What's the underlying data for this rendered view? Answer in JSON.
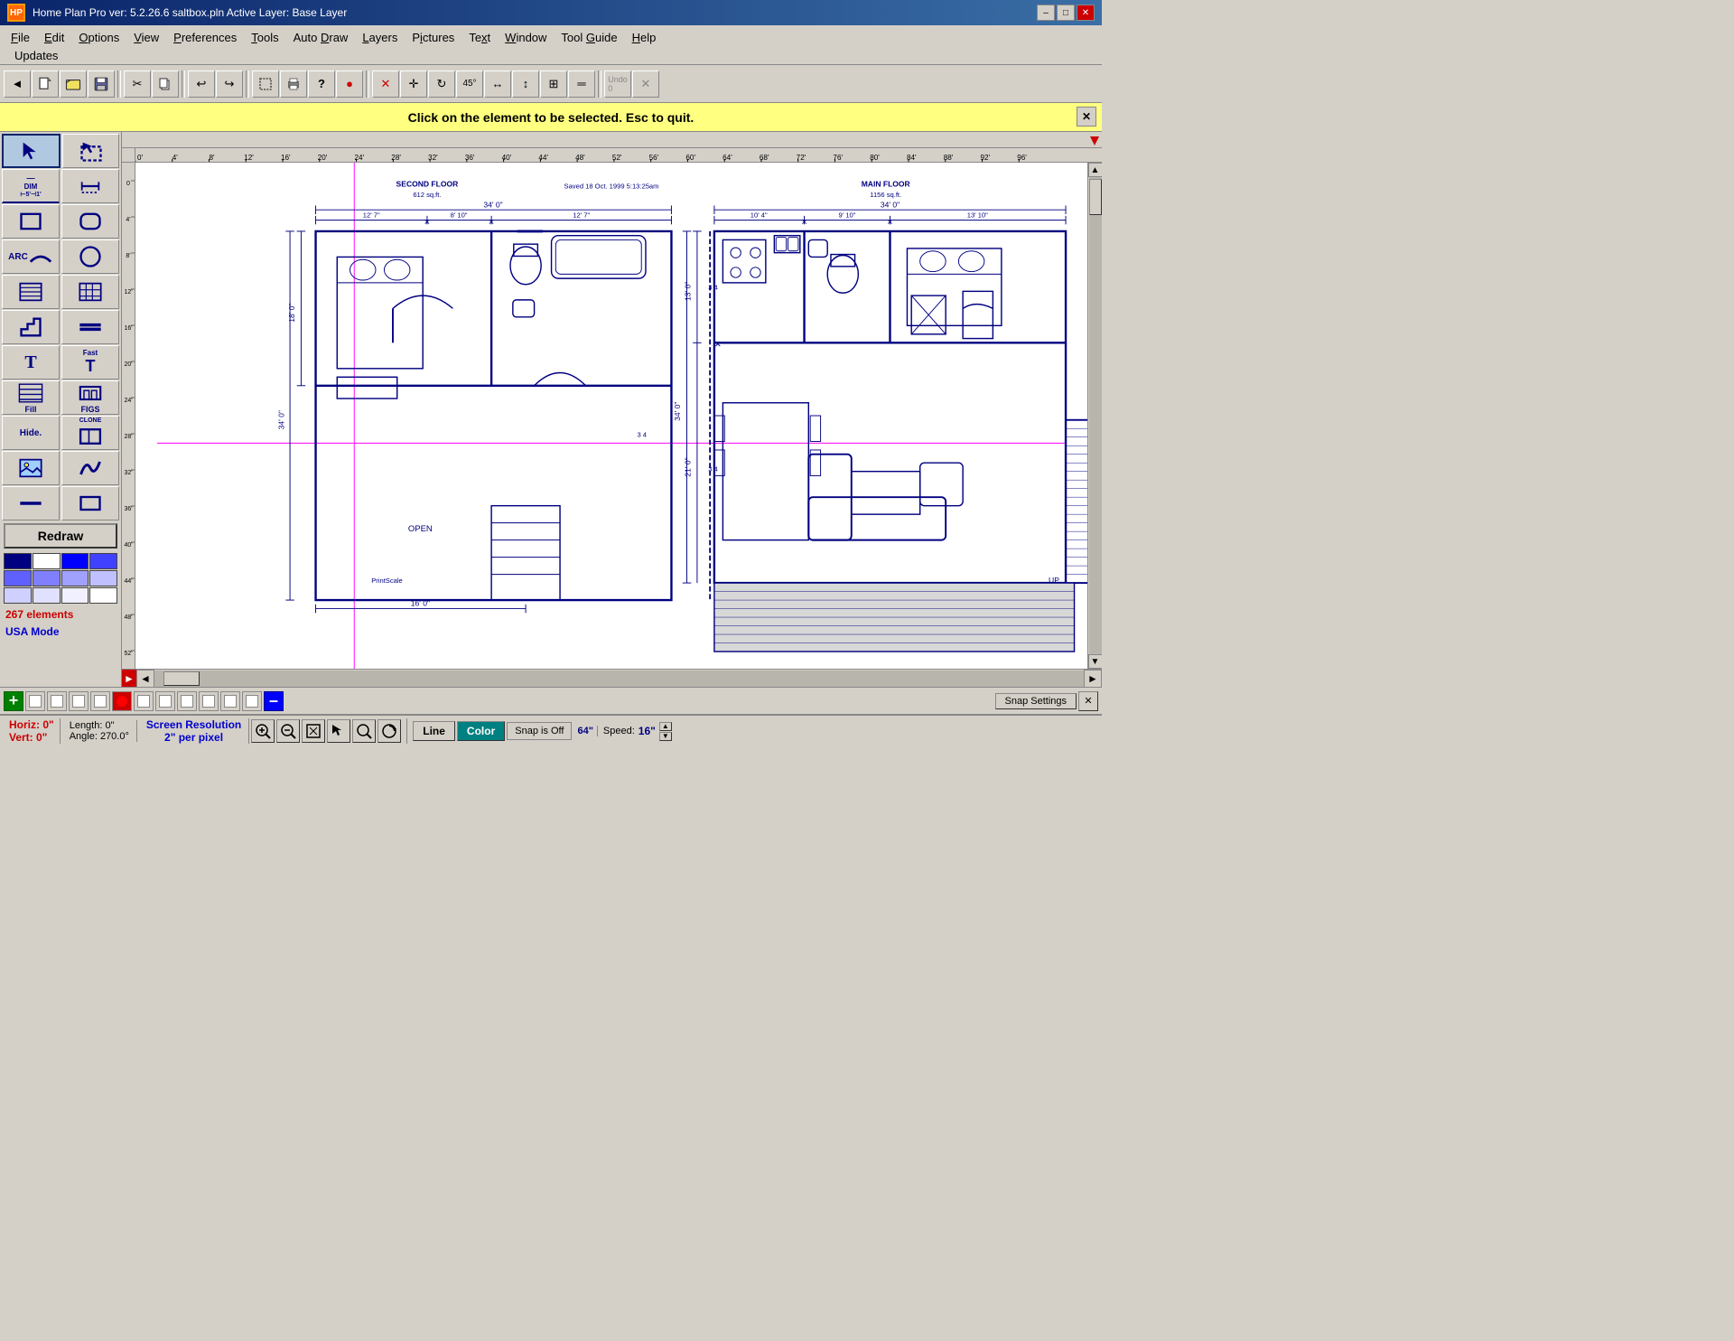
{
  "titlebar": {
    "app_icon": "HP",
    "title": "Home Plan Pro ver: 5.2.26.6    saltbox.pln         Active Layer: Base Layer",
    "minimize": "–",
    "maximize": "□",
    "close": "✕"
  },
  "menubar": {
    "items": [
      {
        "label": "File",
        "key": "F",
        "id": "file"
      },
      {
        "label": "Edit",
        "key": "E",
        "id": "edit"
      },
      {
        "label": "Options",
        "key": "O",
        "id": "options"
      },
      {
        "label": "View",
        "key": "V",
        "id": "view"
      },
      {
        "label": "Preferences",
        "key": "P",
        "id": "preferences"
      },
      {
        "label": "Tools",
        "key": "T",
        "id": "tools"
      },
      {
        "label": "Auto Draw",
        "key": "D",
        "id": "autodraw"
      },
      {
        "label": "Layers",
        "key": "L",
        "id": "layers"
      },
      {
        "label": "Pictures",
        "key": "i",
        "id": "pictures"
      },
      {
        "label": "Text",
        "key": "x",
        "id": "text"
      },
      {
        "label": "Window",
        "key": "W",
        "id": "window"
      },
      {
        "label": "Tool Guide",
        "key": "G",
        "id": "toolguide"
      },
      {
        "label": "Help",
        "key": "H",
        "id": "help"
      }
    ],
    "updates": "Updates"
  },
  "toolbar": {
    "buttons": [
      "📁",
      "📂",
      "💾",
      "✂",
      "📋",
      "↩",
      "↪",
      "⬜",
      "🖨",
      "?",
      "🔴",
      "✕",
      "✛",
      "↻",
      "45°",
      "↔",
      "↕",
      "⊞",
      "═",
      "⟲",
      "✕"
    ]
  },
  "status_message": "Click on the element to be selected.  Esc to quit.",
  "toolbox": {
    "tools": [
      {
        "id": "select-arrow",
        "label": "",
        "symbol": "↖"
      },
      {
        "id": "select-box",
        "label": "",
        "symbol": "⬚"
      },
      {
        "id": "line-tool",
        "label": "DIM",
        "symbol": "—"
      },
      {
        "id": "dim-tool",
        "label": "",
        "symbol": "⊢"
      },
      {
        "id": "rect-tool",
        "label": "",
        "symbol": "□"
      },
      {
        "id": "round-rect",
        "label": "",
        "symbol": "○"
      },
      {
        "id": "arc-tool",
        "label": "ARC",
        "symbol": "⌒"
      },
      {
        "id": "circle-tool",
        "label": "",
        "symbol": "◯"
      },
      {
        "id": "wall-tool",
        "label": "",
        "symbol": "⊞"
      },
      {
        "id": "grid-tool",
        "label": "",
        "symbol": "⊟"
      },
      {
        "id": "stair-tool",
        "label": "",
        "symbol": "⌐"
      },
      {
        "id": "beam-tool",
        "label": "",
        "symbol": "═"
      },
      {
        "id": "text-tool",
        "label": "",
        "symbol": "T"
      },
      {
        "id": "fast-text",
        "label": "Fast",
        "symbol": "T"
      },
      {
        "id": "fill-tool",
        "label": "Fill",
        "symbol": "▦"
      },
      {
        "id": "figs-tool",
        "label": "FIGS",
        "symbol": "🏠"
      },
      {
        "id": "hide-tool",
        "label": "Hide",
        "symbol": "H"
      },
      {
        "id": "clone-tool",
        "label": "CLONE",
        "symbol": "⊞"
      },
      {
        "id": "picture-tool",
        "label": "",
        "symbol": "🖼"
      },
      {
        "id": "spline-tool",
        "label": "",
        "symbol": "∫"
      },
      {
        "id": "line2-tool",
        "label": "",
        "symbol": "—"
      },
      {
        "id": "rect2-tool",
        "label": "",
        "symbol": "▭"
      }
    ],
    "redraw": "Redraw",
    "elements_count": "267 elements",
    "usa_mode": "USA Mode"
  },
  "floorplan": {
    "second_floor_label": "SECOND FLOOR",
    "second_floor_sqft": "612 sq.ft.",
    "main_floor_label": "MAIN FLOOR",
    "main_floor_sqft": "1156 sq.ft.",
    "saved_label": "Saved 18 Oct. 1999  5:13:25am",
    "open_label": "OPEN",
    "print_scale_label": "PrintScale",
    "dim_34_0": "34' 0\"",
    "dim_12_7": "12' 7\"",
    "dim_8_10": "8' 10\"",
    "dim_12_7b": "12' 7\"",
    "dim_18_0": "18' 0\"",
    "dim_34_0b": "34' 0\"",
    "dim_16_0": "16' 0\"",
    "dim_34_0c": "34' 0\"",
    "dim_10_4": "10' 4\"",
    "dim_9_10": "9' 10\"",
    "dim_13_10": "13' 10\"",
    "dim_13_0": "13' 0\"",
    "dim_21_0": "21' 0\""
  },
  "ruler": {
    "ticks": [
      "0'",
      "4'",
      "8'",
      "12'",
      "16'",
      "20'",
      "24'",
      "28'",
      "32'",
      "36'",
      "40'",
      "44'",
      "48'",
      "52'",
      "56'",
      "60'",
      "64'",
      "68'",
      "72'",
      "76'",
      "80'",
      "84'",
      "88'",
      "92'",
      "96'"
    ]
  },
  "bottom_snap": {
    "plus": "+",
    "minus": "–",
    "settings": "Snap Settings"
  },
  "statusbar": {
    "horiz": "Horiz: 0\"",
    "vert": "Vert:  0\"",
    "length": "Length:  0\"",
    "angle": "Angle:  270.0°",
    "screen_res_label": "Screen Resolution",
    "screen_res_value": "2\" per pixel",
    "line_label": "Line",
    "color_label": "Color",
    "snap_label": "Snap is Off",
    "snap_value": "64\"",
    "speed_label": "Speed:",
    "speed_value": "16\""
  },
  "colors": {
    "accent_blue": "#0a246a",
    "floor_plan_color": "#000080",
    "crosshair": "#ff00ff",
    "status_bar_red": "#cc0000",
    "yellow_bg": "#ffff80"
  }
}
